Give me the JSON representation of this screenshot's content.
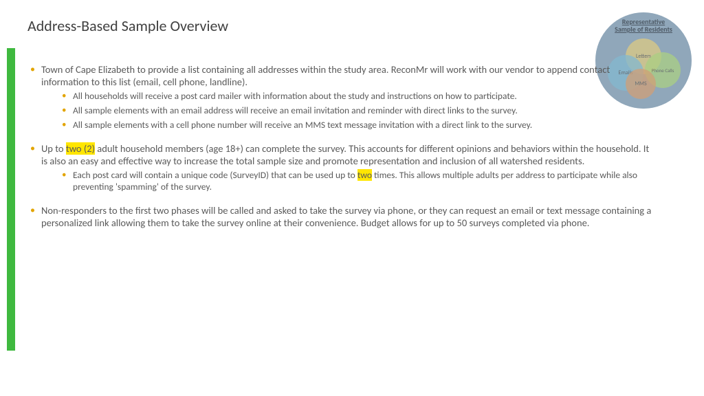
{
  "title": "Address-Based Sample Overview",
  "badge": {
    "title_l1": "Representative",
    "title_l2": "Sample of Residents",
    "circles": {
      "letters": "Letters",
      "emails": "Emails",
      "phone": "Phone Calls",
      "mms": "MMS"
    }
  },
  "b1": {
    "lead": "Town of Cape Elizabeth to provide a list containing all addresses within the study area. ReconMr will work with our vendor to append contact information to this list (email, cell phone, landline).",
    "s1": "All households will receive a post card mailer with information about the study and instructions on how to participate.",
    "s2": "All sample elements with an email address will receive an email invitation and reminder with direct links to the survey.",
    "s3": "All sample elements with a cell phone number will receive an MMS text message invitation with a direct link to the survey."
  },
  "b2": {
    "pre": "Up to ",
    "hl": "two (2)",
    "post": " adult household members (age 18+) can complete the survey. This accounts for different opinions and behaviors within the household. It is also an easy and effective way to increase the total sample size and promote representation and inclusion of all watershed residents.",
    "s1pre": "Each post card will contain a unique code (SurveyID) that can be used up to ",
    "s1hl": "two",
    "s1post": " times. This allows multiple adults per address to participate while also preventing 'spamming' of the survey."
  },
  "b3": "Non-responders to the first two phases will be called and asked to take the survey via phone, or they can request an email or text message containing a personalized link allowing them to take the survey online at their convenience. Budget allows for up to 50 surveys completed via phone."
}
